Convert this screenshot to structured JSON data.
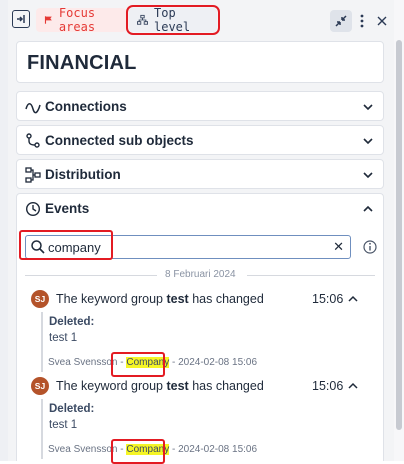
{
  "toolbar": {
    "focus_chip": "Focus areas",
    "top_chip": "Top level"
  },
  "title": "FINANCIAL",
  "sections": [
    {
      "label": "Connections",
      "icon": "wave-icon"
    },
    {
      "label": "Connected sub objects",
      "icon": "branch-icon"
    },
    {
      "label": "Distribution",
      "icon": "distribution-icon"
    }
  ],
  "events": {
    "label": "Events",
    "search_value": "company",
    "date_separator": "8 Februari 2024",
    "items": [
      {
        "avatar": "SJ",
        "title_prefix": "The keyword group ",
        "title_bold": "test",
        "title_suffix": " has changed",
        "time": "15:06",
        "deleted_label": "Deleted:",
        "deleted_value": "test 1",
        "author": "Svea Svensson",
        "separator": " - ",
        "company": "Company",
        "timestamp": " - 2024-02-08 15:06"
      },
      {
        "avatar": "SJ",
        "title_prefix": "The keyword group ",
        "title_bold": "test",
        "title_suffix": " has changed",
        "time": "15:06",
        "deleted_label": "Deleted:",
        "deleted_value": "test 1",
        "author": "Svea Svensson",
        "separator": " - ",
        "company": "Company",
        "timestamp": " - 2024-02-08 15:06"
      }
    ]
  },
  "colors": {
    "accent_red": "#e31b23",
    "highlight": "#f5f525",
    "avatar": "#b4532a"
  }
}
